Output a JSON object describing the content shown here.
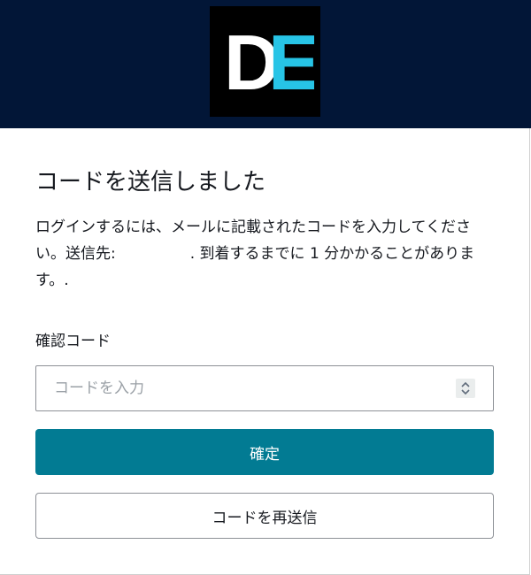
{
  "header": {
    "background": "#021637",
    "logo": {
      "letter_1": "D",
      "letter_2": "E",
      "color_1": "#ffffff",
      "color_2": "#27c4e6",
      "background": "#000000"
    }
  },
  "card": {
    "title": "コードを送信しました",
    "message": {
      "part1": "ログインするには、メールに記載されたコードを入力してください。送信先:",
      "part2": ". 到着するまでに 1 分かかることがあります。."
    },
    "code_field": {
      "label": "確認コード",
      "placeholder": "コードを入力",
      "value": "",
      "icon": "stepper-icon"
    },
    "confirm_button": {
      "label": "確定",
      "color": "#027b93"
    },
    "resend_button": {
      "label": "コードを再送信"
    }
  }
}
